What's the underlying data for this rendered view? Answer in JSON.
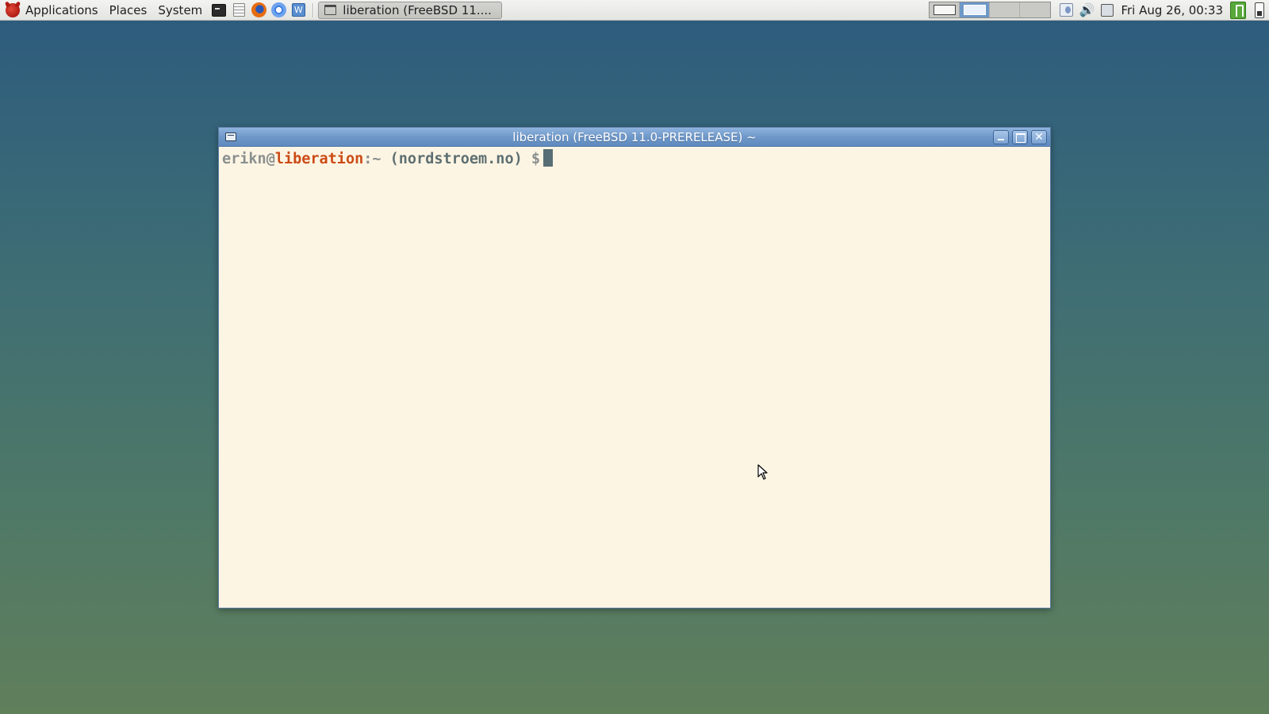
{
  "panel": {
    "menus": [
      {
        "label": "Applications"
      },
      {
        "label": "Places"
      },
      {
        "label": "System"
      }
    ],
    "launchers": [
      "terminal-launcher-icon",
      "text-editor-launcher-icon",
      "firefox-launcher-icon",
      "chromium-launcher-icon",
      "calculator-launcher-icon"
    ],
    "task": {
      "label": "liberation (FreeBSD 11...."
    },
    "workspaces": {
      "count": 4,
      "active_index": 1
    },
    "clock": "Fri Aug 26, 00:33"
  },
  "window": {
    "title": "liberation (FreeBSD 11.0-PRERELEASE) ~",
    "prompt": {
      "user": "erikn",
      "at": "@",
      "host": "liberation",
      "path": ":~ ",
      "domain": "(nordstroem.no)",
      "symbol": " $"
    }
  },
  "colors": {
    "terminal_bg": "#fdf5e3",
    "host": "#cb4b16",
    "user": "#8a8f8f",
    "titlebar": "#6f98c9"
  }
}
